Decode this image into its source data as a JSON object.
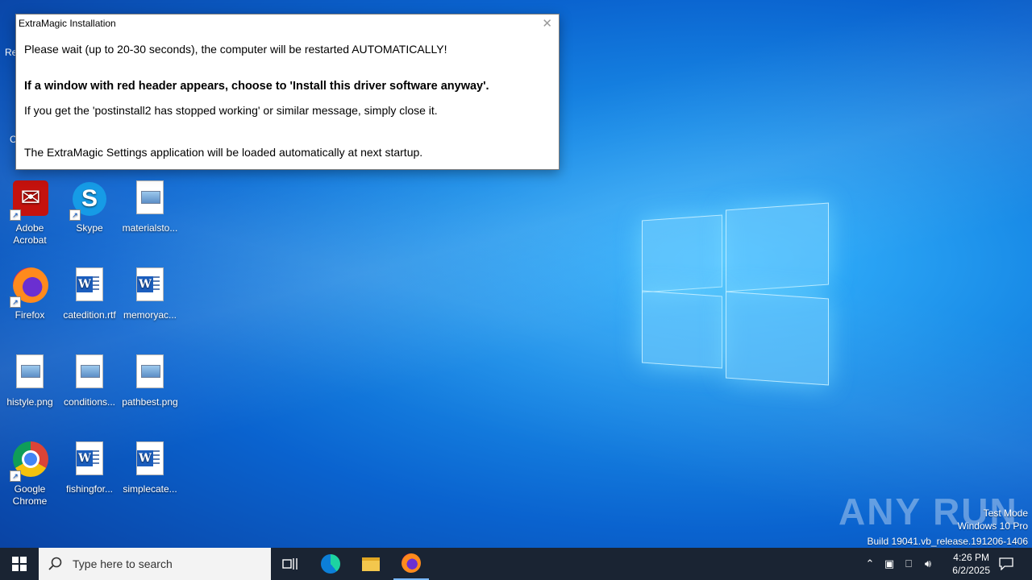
{
  "dialog": {
    "title": "ExtraMagic Installation",
    "line1": "Please wait (up to 20-30 seconds), the computer will be restarted AUTOMATICALLY!",
    "line2": "If a window with red header appears, choose to 'Install this driver software anyway'.",
    "line3": "If you get the 'postinstall2 has stopped working' or similar message, simply close it.",
    "line4": "The ExtraMagic Settings application will be loaded automatically at next startup."
  },
  "desktop": {
    "icons": [
      {
        "label": "Adobe\nAcrobat"
      },
      {
        "label": "Skype"
      },
      {
        "label": "materialsto..."
      },
      {
        "label": "Firefox"
      },
      {
        "label": "catedition.rtf"
      },
      {
        "label": "memoryac..."
      },
      {
        "label": "histyle.png"
      },
      {
        "label": "conditions..."
      },
      {
        "label": "pathbest.png"
      },
      {
        "label": "Google\nChrome"
      },
      {
        "label": "fishingfor..."
      },
      {
        "label": "simplecate..."
      }
    ],
    "partial_left_labels": [
      "Re",
      "C"
    ]
  },
  "watermark": {
    "brand": "ANY RUN",
    "test_mode": "Test Mode",
    "edition": "Windows 10 Pro",
    "build": "Build 19041.vb_release.191206-1406"
  },
  "taskbar": {
    "search_placeholder": "Type here to search",
    "time": "4:26 PM",
    "date": "6/2/2025"
  }
}
